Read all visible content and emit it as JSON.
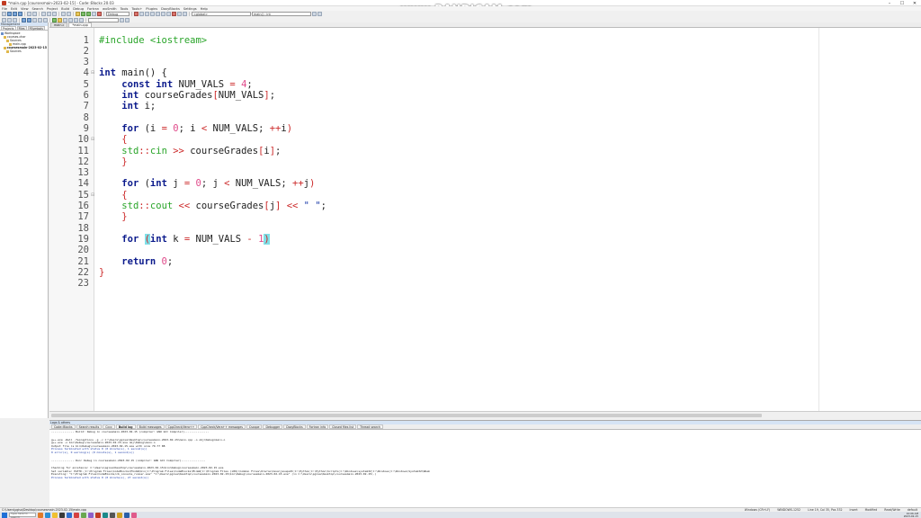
{
  "window": {
    "title": "*main.cpp [coursesmain-2023-02-15] - Code::Blocks 20.03",
    "controls": [
      "–",
      "☐",
      "✕"
    ]
  },
  "watermark": "www.BANDICAM.com",
  "menubar": [
    "File",
    "Edit",
    "View",
    "Search",
    "Project",
    "Build",
    "Debug",
    "Fortran",
    "wxSmith",
    "Tools",
    "Tools+",
    "Plugins",
    "DoxyBlocks",
    "Settings",
    "Help"
  ],
  "toolbar": {
    "build_target": "Debug",
    "scope": "<global>",
    "symbol": "main() : int"
  },
  "management": {
    "title": "Management",
    "tabs": [
      "Projects",
      "Files",
      "FSymbols"
    ],
    "tree": [
      {
        "label": "Workspace",
        "indent": 0,
        "type": "ws"
      },
      {
        "label": "courses-char",
        "indent": 1,
        "type": "proj"
      },
      {
        "label": "Sources",
        "indent": 2,
        "type": "folder"
      },
      {
        "label": "main.cpp",
        "indent": 3,
        "type": "file"
      },
      {
        "label": "coursesmain-2023-02-15",
        "indent": 1,
        "type": "proj",
        "bold": true
      },
      {
        "label": "Sources",
        "indent": 2,
        "type": "folder"
      }
    ]
  },
  "editor": {
    "tabs": [
      "main.c",
      "*main.cpp"
    ],
    "active_tab": 1,
    "lines": [
      {
        "n": "1",
        "fold": ""
      },
      {
        "n": "2",
        "fold": ""
      },
      {
        "n": "3",
        "fold": ""
      },
      {
        "n": "4",
        "fold": "⊟"
      },
      {
        "n": "5",
        "fold": ""
      },
      {
        "n": "6",
        "fold": ""
      },
      {
        "n": "7",
        "fold": ""
      },
      {
        "n": "8",
        "fold": ""
      },
      {
        "n": "9",
        "fold": ""
      },
      {
        "n": "10",
        "fold": "⊟"
      },
      {
        "n": "11",
        "fold": ""
      },
      {
        "n": "12",
        "fold": ""
      },
      {
        "n": "13",
        "fold": ""
      },
      {
        "n": "14",
        "fold": ""
      },
      {
        "n": "15",
        "fold": "⊟"
      },
      {
        "n": "16",
        "fold": ""
      },
      {
        "n": "17",
        "fold": ""
      },
      {
        "n": "18",
        "fold": ""
      },
      {
        "n": "19",
        "fold": ""
      },
      {
        "n": "20",
        "fold": ""
      },
      {
        "n": "21",
        "fold": ""
      },
      {
        "n": "22",
        "fold": ""
      },
      {
        "n": "23",
        "fold": ""
      }
    ],
    "code": {
      "l1_pp": "#include <iostream>",
      "l4_kw": "int",
      "l4_rest": " main() {",
      "l5_kw1": "const",
      "l5_kw2": "int",
      "l5_id": " NUM_VALS ",
      "l5_eq": "=",
      "l5_num": "4",
      "l5_end": ";",
      "l6_kw": "int",
      "l6_id": " courseGrades",
      "l6_br1": "[",
      "l6_mid": "NUM_VALS",
      "l6_br2": "]",
      "l6_end": ";",
      "l7_kw": "int",
      "l7_rest": " i;",
      "l9_kw": "for",
      "l9_p1": " (",
      "l9_i1": "i ",
      "l9_eq": "=",
      "l9_zero": " 0",
      "l9_semi1": "; i ",
      "l9_lt": "<",
      "l9_nv": " NUM_VALS; ",
      "l9_inc": "++",
      "l9_i2": "i",
      "l9_p2": ")",
      "l10": "{",
      "l11_std": "std",
      "l11_cc": "::",
      "l11_cin": "cin",
      "l11_sp": " ",
      "l11_op": ">>",
      "l11_cg": " courseGrades",
      "l11_b1": "[",
      "l11_i": "i",
      "l11_b2": "]",
      "l11_end": ";",
      "l12": "}",
      "l14_kw": "for",
      "l14_p1": " (",
      "l14_int": "int",
      "l14_j": " j ",
      "l14_eq": "=",
      "l14_zero": " 0",
      "l14_semi": "; j ",
      "l14_lt": "<",
      "l14_nv": " NUM_VALS; ",
      "l14_inc": "++",
      "l14_j2": "j",
      "l14_p2": ")",
      "l15": "{",
      "l16_std": "std",
      "l16_cc": "::",
      "l16_cout": "cout",
      "l16_sp": " ",
      "l16_op1": "<<",
      "l16_cg": " courseGrades",
      "l16_b1": "[",
      "l16_j": "j",
      "l16_b2": "]",
      "l16_sp2": " ",
      "l16_op2": "<<",
      "l16_str": " \" \"",
      "l16_end": ";",
      "l17": "}",
      "l19_kw": "for",
      "l19_sp": " ",
      "l19_p1": "(",
      "l19_int": "int",
      "l19_k": " k ",
      "l19_eq": "=",
      "l19_nv": " NUM_VALS ",
      "l19_minus": "-",
      "l19_sp2": " ",
      "l19_one": "1",
      "l19_p2": ")",
      "l21_kw": "return",
      "l21_zero": " 0",
      "l21_end": ";",
      "l22": "}"
    }
  },
  "logs": {
    "title": "Logs & others",
    "tabs": [
      "Code::Blocks",
      "Search results",
      "Cccc",
      "Build log",
      "Build messages",
      "CppCheck/Vera++",
      "CppCheck/Vera++ messages",
      "Cscope",
      "Debugger",
      "DoxyBlocks",
      "Fortran info",
      "Closed files list",
      "Thread search"
    ],
    "active_tab": 3,
    "lines": [
      {
        "text": "-------------- Build: Debug in coursesmain-2023-02-15 (compiler: GNU GCC Compiler)---------------",
        "cls": ""
      },
      {
        "text": "",
        "cls": "gap"
      },
      {
        "text": "g++.exe -Wall -fexceptions -g  -c C:\\Users\\pgisa\\Desktop\\coursesmain-2023-02-15\\main.cpp -o obj\\Debug\\main.o",
        "cls": ""
      },
      {
        "text": "g++.exe  -o bin\\Debug\\coursesmain-2023-02-15.exe obj\\Debug\\main.o",
        "cls": ""
      },
      {
        "text": "Output file is bin\\Debug\\coursesmain-2023-02-15.exe with size 79.77 KB",
        "cls": ""
      },
      {
        "text": "Process terminated with status 0 (0 minute(s), 1 second(s))",
        "cls": "blue"
      },
      {
        "text": "0 error(s), 0 warning(s) (0 minute(s), 1 second(s))",
        "cls": "blue"
      },
      {
        "text": "",
        "cls": "gap"
      },
      {
        "text": "-------------- Run: Debug in coursesmain-2023-02-15 (compiler: GNU GCC Compiler)---------------",
        "cls": ""
      },
      {
        "text": "",
        "cls": "gap"
      },
      {
        "text": "Checking for existence: C:\\Users\\pgisa\\Desktop\\coursesmain-2023-02-15\\bin\\Debug\\coursesmain-2023-02-15.exe",
        "cls": ""
      },
      {
        "text": "Set variable: PATH=.;C:\\Program Files\\CodeBlocks\\MinGW\\bin;C:\\Program Files\\CodeBlocks\\MinGW;C:\\Program Files (x86)\\Common Files\\Oracle\\Java\\javapath;C:\\Python;C:\\Python\\Scripts;C:\\Windows\\system32;C:\\Windows;C:\\Windows\\System32\\Wbem",
        "cls": ""
      },
      {
        "text": "Executing: \"C:\\Program Files\\CodeBlocks/cb_console_runner.exe\" \"C:\\Users\\pgisa\\Desktop\\coursesmain-2023-02-15\\bin\\Debug\\coursesmain-2023-02-15.exe\"  (in C:\\Users\\pgisa\\Desktop\\coursesmain-2023-02-15\\.)",
        "cls": ""
      },
      {
        "text": "Process terminated with status 0 (0 minute(s), 27 second(s))",
        "cls": "blue"
      }
    ]
  },
  "statusbar": {
    "path": "C:\\Users\\pgisa\\Desktop\\coursesmain-2023-02-15\\main.cpp",
    "segments": [
      "Windows (CR+LF)",
      "WINDOWS-1252",
      "Line 19, Col 35, Pos 332",
      "Insert",
      "Modified",
      "Read/Write",
      "default"
    ]
  },
  "taskbar": {
    "search_placeholder": "Type here to search",
    "apps": [
      "#e07a2a",
      "#2a8fd6",
      "#f0c030",
      "#3a3a3a",
      "#2f6fd0",
      "#d64040",
      "#6aa84f",
      "#8e5fc8",
      "#c23b22",
      "#1a8a8a",
      "#555555",
      "#d0a020",
      "#2a5fa8",
      "#e05a8a"
    ],
    "time": "10:06 AM",
    "date": "2023-02-15"
  }
}
